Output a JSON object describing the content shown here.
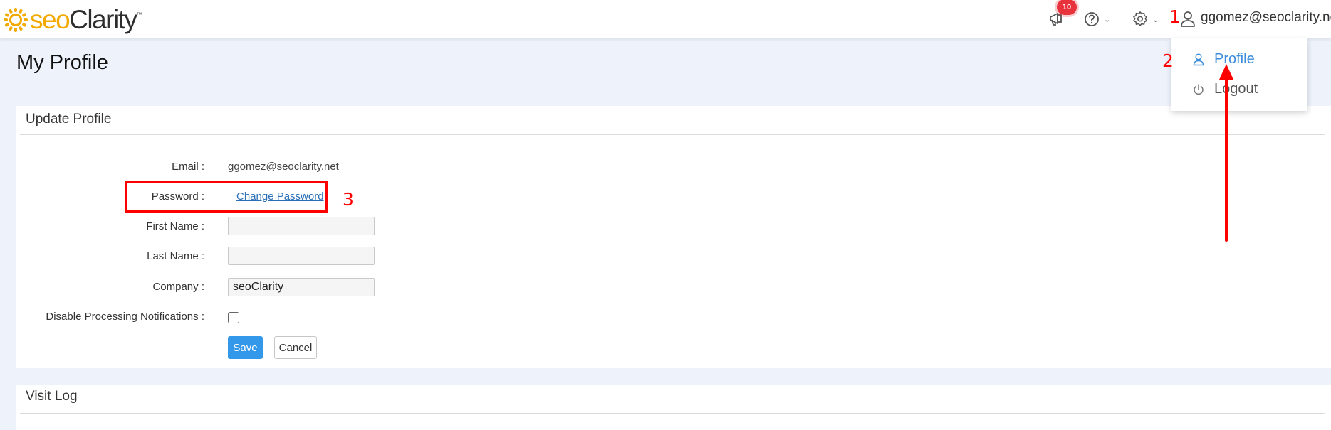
{
  "header": {
    "logo_seo": "seo",
    "logo_clarity": "Clarity",
    "logo_tm": "™",
    "notification_count": "10",
    "user_email": "ggomez@seoclarity.net"
  },
  "user_menu": {
    "items": [
      {
        "label": "Profile",
        "icon": "user-icon"
      },
      {
        "label": "Logout",
        "icon": "power-icon"
      }
    ]
  },
  "page": {
    "title": "My Profile"
  },
  "update_profile": {
    "title": "Update Profile",
    "email_label": "Email :",
    "email_value": "ggomez@seoclarity.net",
    "password_label": "Password :",
    "change_password_link": "Change Password",
    "first_name_label": "First Name :",
    "first_name_value": "",
    "last_name_label": "Last Name :",
    "last_name_value": "",
    "company_label": "Company :",
    "company_value": "seoClarity",
    "disable_notifications_label": "Disable Processing Notifications :",
    "disable_notifications_checked": false,
    "save_label": "Save",
    "cancel_label": "Cancel"
  },
  "visit_log": {
    "title": "Visit Log"
  },
  "annotations": {
    "step1": "1",
    "step2": "2",
    "step3": "3"
  },
  "colors": {
    "accent": "#3398ea",
    "brand_orange": "#f2a900",
    "annotation_red": "#ff0000",
    "badge_red": "#e8323c"
  }
}
